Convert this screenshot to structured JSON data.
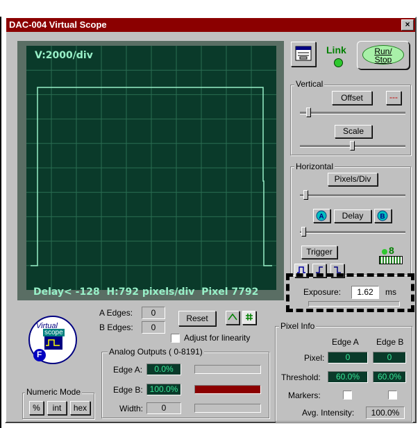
{
  "window": {
    "title": "DAC-004 Virtual Scope",
    "close_label": "×"
  },
  "scope": {
    "vertical_readout": "V:2000/div",
    "status_line": "Delay< -128  H:792 pixels/div  Pixel 7792",
    "background": "#0a3a2a",
    "grid_color": "#2a6e52",
    "trace_color": "#98f0c8"
  },
  "header": {
    "link_label": "Link",
    "run_stop_label": "Run/\nStop",
    "link_color": "#2ec82e"
  },
  "vertical": {
    "title": "Vertical",
    "offset_label": "Offset",
    "offset_extra": "---",
    "scale_label": "Scale",
    "offset_level": 0.05,
    "scale_level": 0.5
  },
  "horizontal": {
    "title": "Horizontal",
    "pixels_per_div_label": "Pixels/Div",
    "delay_label": "Delay",
    "delay_a_icon": "a-left-icon",
    "delay_b_icon": "b-right-icon",
    "trigger_label": "Trigger",
    "trigger_count": "8",
    "pixels_level": 0.02,
    "delay_level": 0.0
  },
  "exposure": {
    "label": "Exposure:",
    "value": "1.62",
    "unit": "ms"
  },
  "edges": {
    "a_label": "A Edges:",
    "a_value": "0",
    "b_label": "B Edges:",
    "b_value": "0",
    "reset_label": "Reset",
    "linearity_label": "Adjust for linearity"
  },
  "analog_outputs": {
    "title": "Analog Outputs ( 0-8191)",
    "edge_a_label": "Edge A:",
    "edge_a_value": "0.0%",
    "edge_a_fill": 0.0,
    "edge_b_label": "Edge B:",
    "edge_b_value": "100.0%",
    "edge_b_fill": 1.0,
    "width_label": "Width:",
    "width_value": "0",
    "width_fill": 0.0
  },
  "numeric_mode": {
    "title": "Numeric Mode",
    "percent_label": "%",
    "int_label": "int",
    "hex_label": "hex"
  },
  "pixel_info": {
    "title": "Pixel Info",
    "edge_a_header": "Edge A",
    "edge_b_header": "Edge B",
    "pixel_label": "Pixel:",
    "pixel_a": "0",
    "pixel_b": "0",
    "threshold_label": "Threshold:",
    "threshold_a": "60.0%",
    "threshold_b": "60.0%",
    "markers_label": "Markers:",
    "avg_label": "Avg. Intensity:",
    "avg_value": "100.0%"
  },
  "logo": {
    "line1": "Virtual",
    "line2": "scope",
    "badge": "F"
  }
}
